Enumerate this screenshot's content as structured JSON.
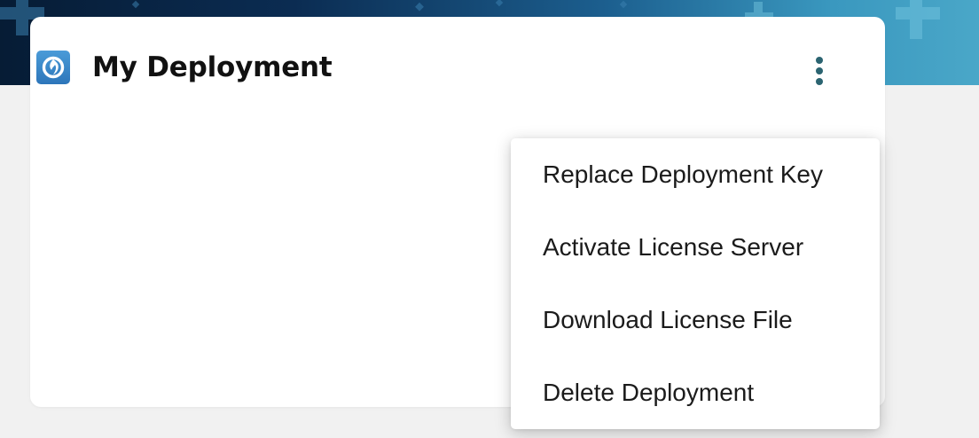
{
  "banner": {
    "background_colors": [
      "#061c35",
      "#1c5f8f",
      "#4aa7c8"
    ],
    "decoration_icon": "plus-cross-icon"
  },
  "card": {
    "title": "My Deployment",
    "logo_icon": "deployment-logo-icon",
    "menu_icon": "kebab-menu-icon"
  },
  "menu": {
    "items": [
      {
        "label": "Replace Deployment Key"
      },
      {
        "label": "Activate License Server"
      },
      {
        "label": "Download License File"
      },
      {
        "label": "Delete Deployment"
      }
    ]
  },
  "colors": {
    "page_background": "#f1f1f1",
    "card_background": "#ffffff",
    "accent": "#2b6471",
    "logo": "#2d76ba"
  }
}
